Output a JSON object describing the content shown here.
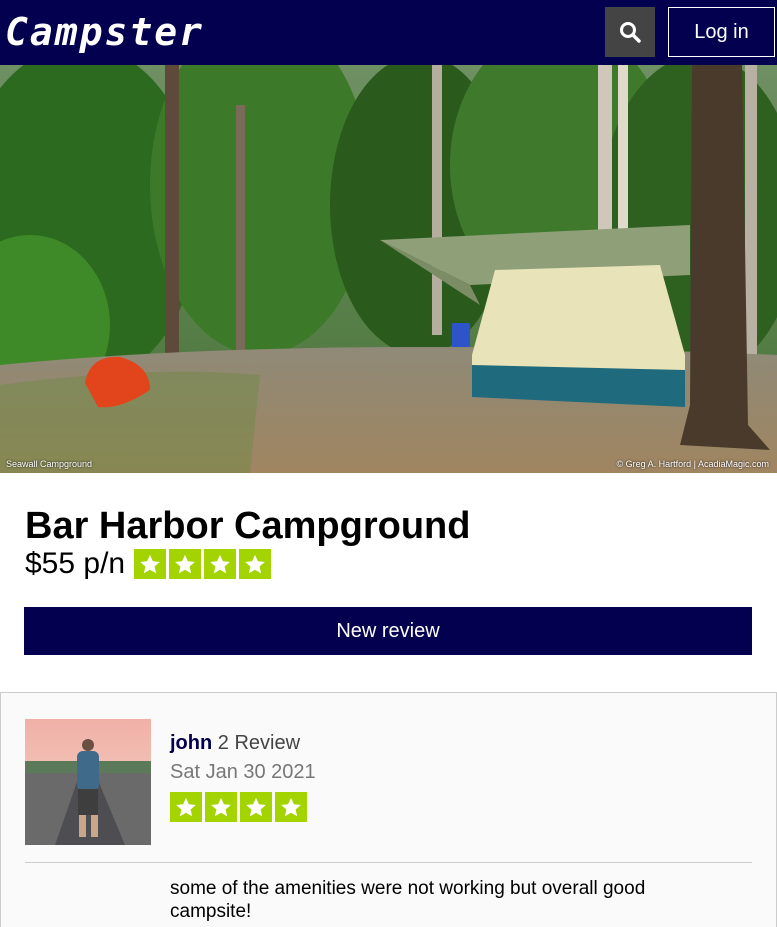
{
  "header": {
    "logo": "Campster",
    "login_label": "Log in",
    "search_icon": "search-icon"
  },
  "hero": {
    "caption_left": "Seawall Campground",
    "caption_right": "© Greg A. Hartford | AcadiaMagic.com"
  },
  "campground": {
    "name": "Bar Harbor Campground",
    "price": "$55 p/n",
    "rating": 4,
    "rating_max": 4
  },
  "new_review_label": "New review",
  "reviews": [
    {
      "username": "john",
      "review_count": "2 Review",
      "date": "Sat Jan 30 2021",
      "rating": 4,
      "text": "some of the amenities were not working but overall good campsite!"
    }
  ],
  "colors": {
    "brand": "#03004f",
    "star": "#a3d400"
  }
}
